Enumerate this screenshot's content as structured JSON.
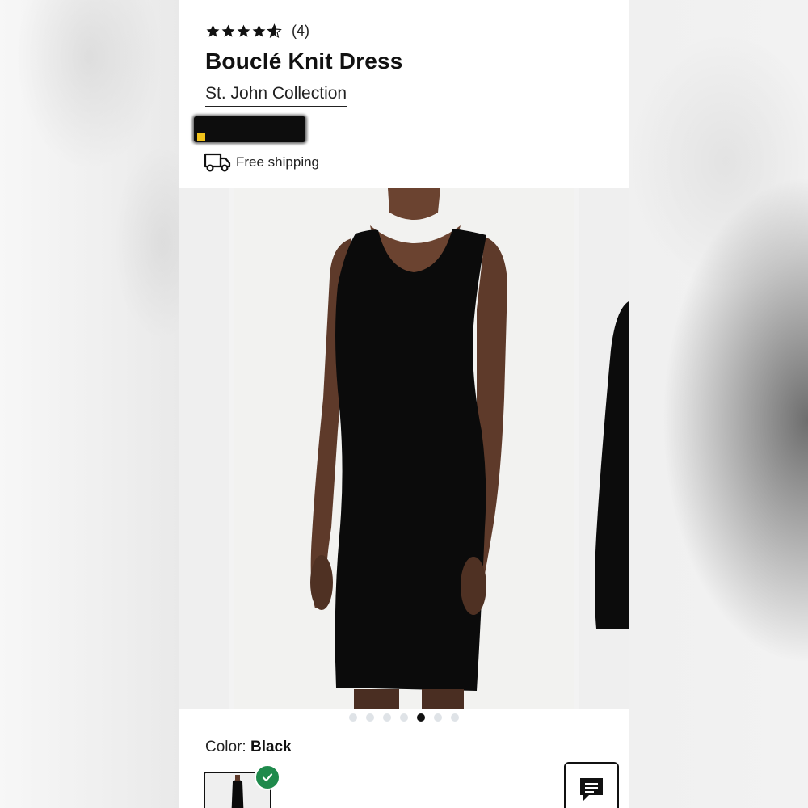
{
  "product": {
    "rating": 4.5,
    "rating_max": 5,
    "review_count": "(4)",
    "title": "Bouclé Knit Dress",
    "brand": "St. John Collection",
    "shipping": "Free shipping"
  },
  "gallery": {
    "image_count": 7,
    "active_index": 4
  },
  "color": {
    "label": "Color:",
    "value": "Black"
  },
  "icons": {
    "rating": "star-icon",
    "shipping": "truck-icon",
    "selected": "check-icon",
    "chat": "chat-icon"
  },
  "colors": {
    "accent_check": "#1f8a4c",
    "text": "#111111",
    "dot_inactive": "#dfe3e7",
    "dot_active": "#111111"
  }
}
